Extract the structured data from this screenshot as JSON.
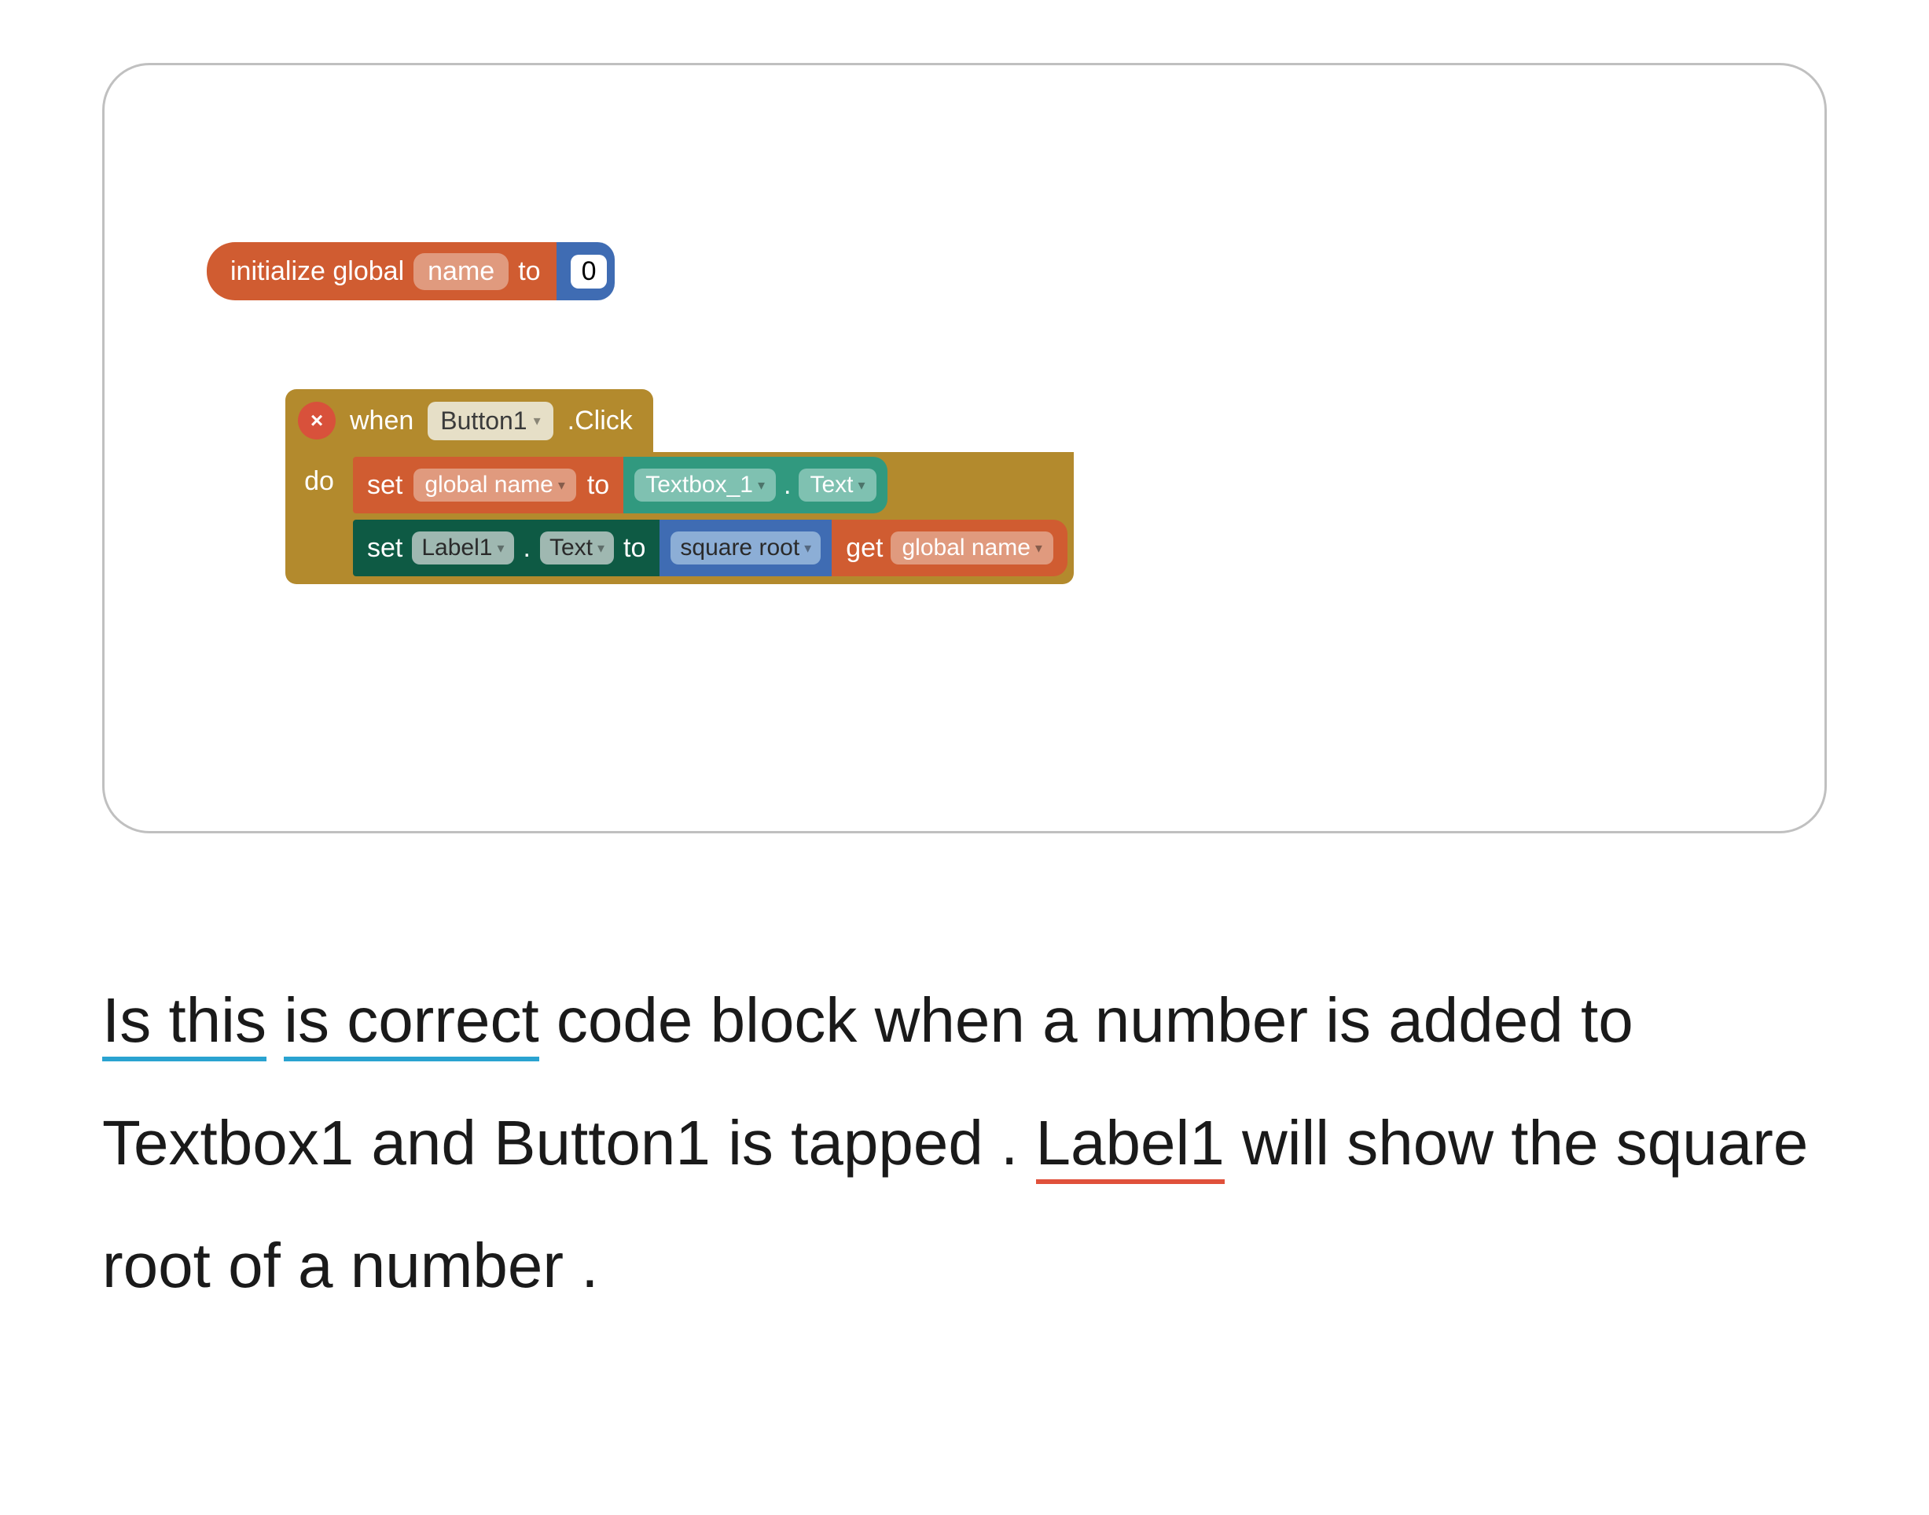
{
  "init_block": {
    "prefix": "initialize global",
    "name": "name",
    "to": "to",
    "value": "0"
  },
  "when_block": {
    "when": "when",
    "component": "Button1",
    "event": ".Click",
    "do": "do",
    "error_symbol": "×",
    "row1": {
      "set": "set",
      "var": "global name",
      "to": "to",
      "comp": "Textbox_1",
      "dot": ".",
      "prop": "Text"
    },
    "row2": {
      "set": "set",
      "label": "Label1",
      "dot1": ".",
      "text": "Text",
      "to": "to",
      "op": "square root",
      "get": "get",
      "var": "global name"
    }
  },
  "question": {
    "part1a": "Is this",
    "part1b": "is correct",
    "part1c": " code block when a number is added to Textbox1 and Button1 is tapped . ",
    "label_word": "Label1",
    "rest": " will show the square root of a number ."
  },
  "colors": {
    "orange": "#d05c31",
    "orange_light": "#e09a7e",
    "blue": "#3f6cb3",
    "blue_light": "#8caed6",
    "mustard": "#b38a2d",
    "green": "#31997f",
    "green_light": "#7fc1b1",
    "darkgreen": "#0e5a44",
    "red": "#d8513b",
    "underline_blue": "#2aa3d1",
    "underline_red": "#e0513b"
  }
}
